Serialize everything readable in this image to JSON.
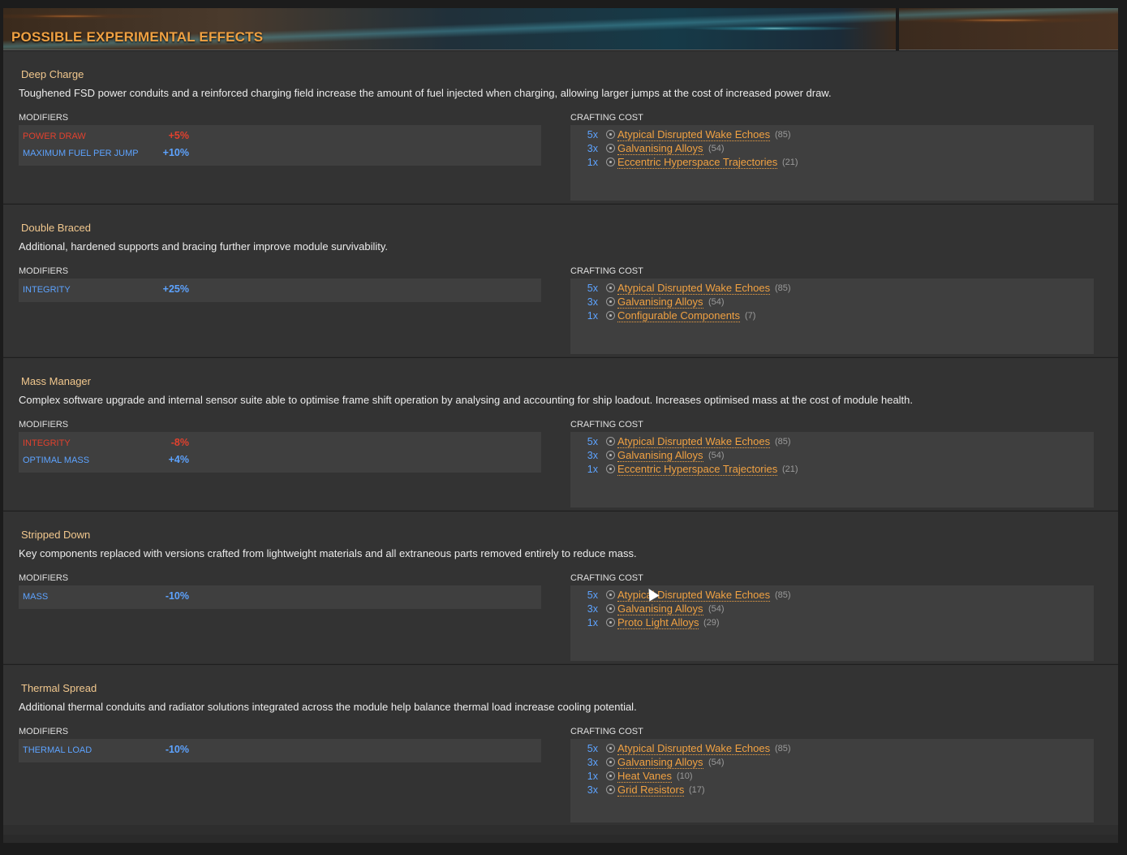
{
  "banner": {
    "title": "POSSIBLE EXPERIMENTAL EFFECTS"
  },
  "labels": {
    "modifiers": "MODIFIERS",
    "crafting_cost": "CRAFTING COST"
  },
  "colors": {
    "accent": "#f0a142",
    "positive": "#5da3ff",
    "negative": "#e2412e"
  },
  "effects": [
    {
      "name": "Deep Charge",
      "description": "Toughened FSD power conduits and a reinforced charging field increase the amount of fuel injected when charging, allowing larger jumps at the cost of increased power draw.",
      "modifiers": [
        {
          "label": "POWER DRAW",
          "value": "+5%",
          "type": "negative"
        },
        {
          "label": "MAXIMUM FUEL PER JUMP",
          "value": "+10%",
          "type": "positive"
        }
      ],
      "costs": [
        {
          "qty": "5x",
          "name": "Atypical Disrupted Wake Echoes",
          "count": "(85)",
          "icon": "grade-icon"
        },
        {
          "qty": "3x",
          "name": "Galvanising Alloys",
          "count": "(54)",
          "icon": "grade-icon"
        },
        {
          "qty": "1x",
          "name": "Eccentric Hyperspace Trajectories",
          "count": "(21)",
          "icon": "grade-icon"
        }
      ]
    },
    {
      "name": "Double Braced",
      "description": "Additional, hardened supports and bracing further improve module survivability.",
      "modifiers": [
        {
          "label": "INTEGRITY",
          "value": "+25%",
          "type": "positive"
        }
      ],
      "costs": [
        {
          "qty": "5x",
          "name": "Atypical Disrupted Wake Echoes",
          "count": "(85)",
          "icon": "grade-icon"
        },
        {
          "qty": "3x",
          "name": "Galvanising Alloys",
          "count": "(54)",
          "icon": "grade-icon"
        },
        {
          "qty": "1x",
          "name": "Configurable Components",
          "count": "(7)",
          "icon": "grade-icon"
        }
      ]
    },
    {
      "name": "Mass Manager",
      "description": "Complex software upgrade and internal sensor suite able to optimise frame shift operation by analysing and accounting for ship loadout. Increases optimised mass at the cost of module health.",
      "modifiers": [
        {
          "label": "INTEGRITY",
          "value": "-8%",
          "type": "negative"
        },
        {
          "label": "OPTIMAL MASS",
          "value": "+4%",
          "type": "positive"
        }
      ],
      "costs": [
        {
          "qty": "5x",
          "name": "Atypical Disrupted Wake Echoes",
          "count": "(85)",
          "icon": "grade-icon"
        },
        {
          "qty": "3x",
          "name": "Galvanising Alloys",
          "count": "(54)",
          "icon": "grade-icon"
        },
        {
          "qty": "1x",
          "name": "Eccentric Hyperspace Trajectories",
          "count": "(21)",
          "icon": "grade-icon"
        }
      ]
    },
    {
      "name": "Stripped Down",
      "description": "Key components replaced with versions crafted from lightweight materials and all extraneous parts removed entirely to reduce mass.",
      "modifiers": [
        {
          "label": "MASS",
          "value": "-10%",
          "type": "positive"
        }
      ],
      "costs": [
        {
          "qty": "5x",
          "name": "Atypical Disrupted Wake Echoes",
          "count": "(85)",
          "icon": "grade-icon"
        },
        {
          "qty": "3x",
          "name": "Galvanising Alloys",
          "count": "(54)",
          "icon": "grade-icon"
        },
        {
          "qty": "1x",
          "name": "Proto Light Alloys",
          "count": "(29)",
          "icon": "grade-icon"
        }
      ]
    },
    {
      "name": "Thermal Spread",
      "description": "Additional thermal conduits and radiator solutions integrated across the module help balance thermal load increase cooling potential.",
      "modifiers": [
        {
          "label": "THERMAL LOAD",
          "value": "-10%",
          "type": "positive"
        }
      ],
      "costs": [
        {
          "qty": "5x",
          "name": "Atypical Disrupted Wake Echoes",
          "count": "(85)",
          "icon": "grade-icon"
        },
        {
          "qty": "3x",
          "name": "Galvanising Alloys",
          "count": "(54)",
          "icon": "grade-icon"
        },
        {
          "qty": "1x",
          "name": "Heat Vanes",
          "count": "(10)",
          "icon": "grade-icon"
        },
        {
          "qty": "3x",
          "name": "Grid Resistors",
          "count": "(17)",
          "icon": "grade-icon"
        }
      ]
    }
  ]
}
